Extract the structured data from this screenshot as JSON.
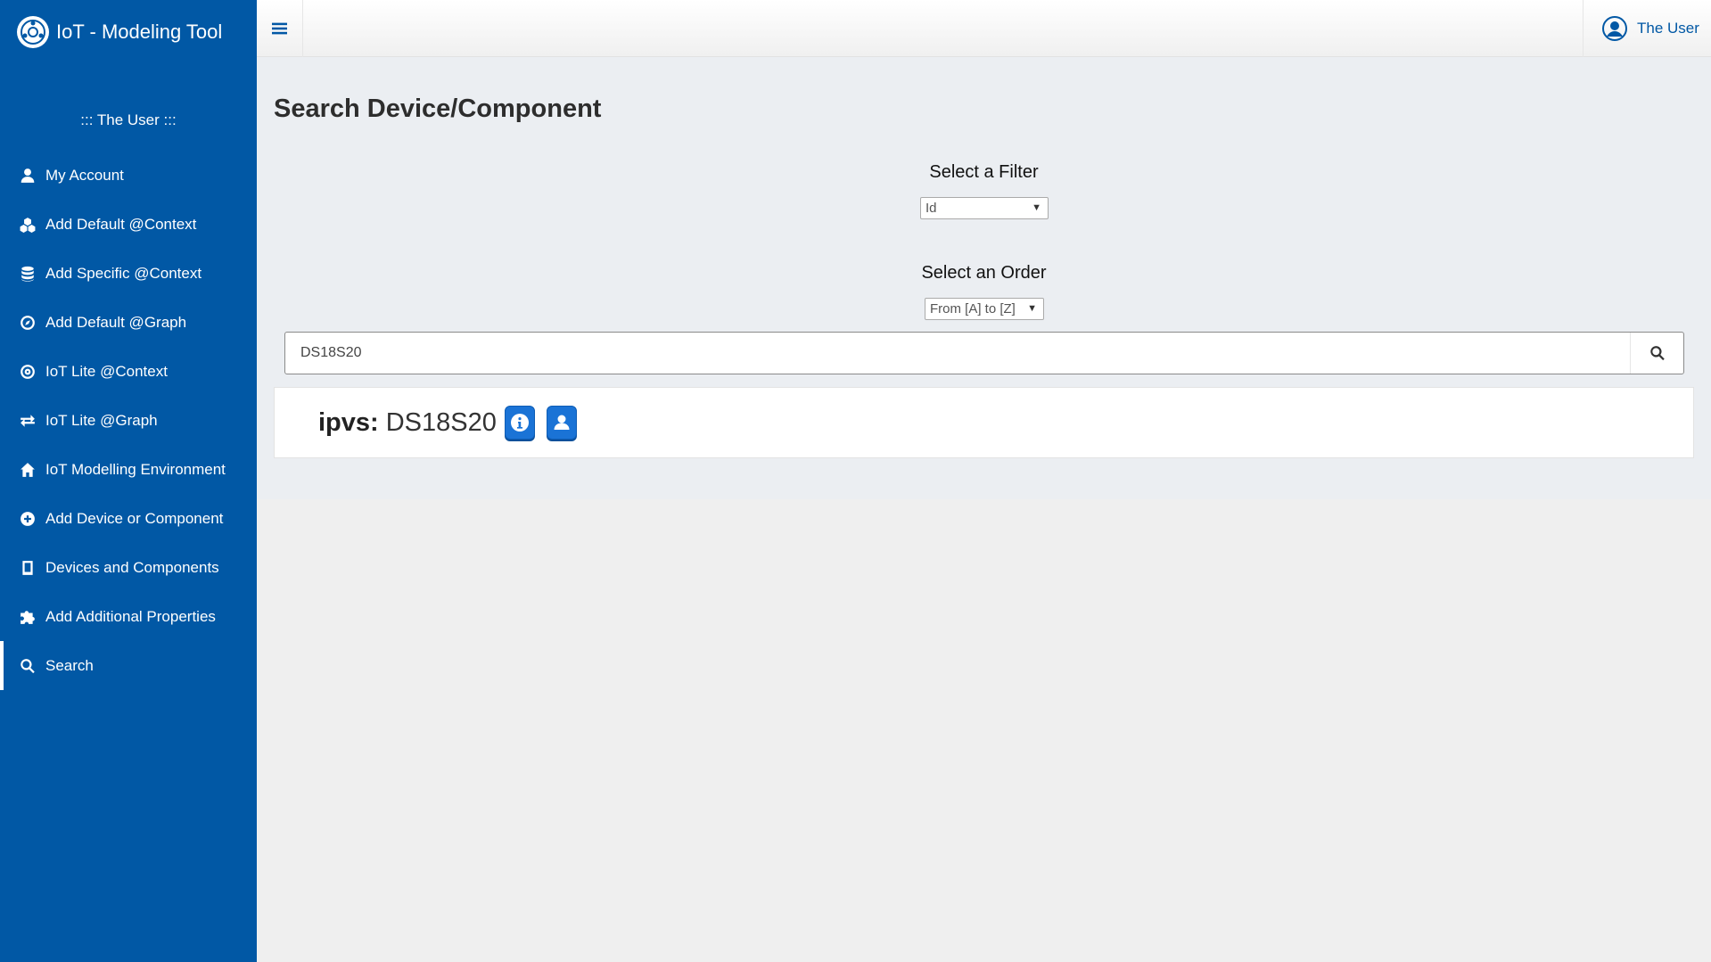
{
  "app": {
    "title": "IoT - Modeling Tool",
    "logo_icon": "iot-logo-icon"
  },
  "sidebar": {
    "user_line": "::: The User :::",
    "items": [
      {
        "label": "My Account",
        "icon": "user-icon"
      },
      {
        "label": "Add Default @Context",
        "icon": "cubes-icon"
      },
      {
        "label": "Add Specific @Context",
        "icon": "database-icon"
      },
      {
        "label": "Add Default @Graph",
        "icon": "compass-icon"
      },
      {
        "label": "IoT Lite @Context",
        "icon": "bullseye-icon"
      },
      {
        "label": "IoT Lite @Graph",
        "icon": "exchange-icon"
      },
      {
        "label": "IoT Modelling Environment",
        "icon": "home-icon"
      },
      {
        "label": "Add Device or Component",
        "icon": "plus-circle-icon"
      },
      {
        "label": "Devices and Components",
        "icon": "tablet-icon"
      },
      {
        "label": "Add Additional Properties",
        "icon": "puzzle-icon"
      },
      {
        "label": "Search",
        "icon": "search-icon",
        "active": true
      }
    ],
    "color": "#0158a5"
  },
  "topbar": {
    "menu_icon": "hamburger-icon",
    "user_name": "The User"
  },
  "main": {
    "page_title": "Search Device/Component",
    "filter": {
      "label": "Select a Filter",
      "selected": "Id"
    },
    "order": {
      "label": "Select an Order",
      "selected": "From [A] to [Z]"
    },
    "search": {
      "value": "DS18S20",
      "placeholder": ""
    },
    "results": [
      {
        "prefix": "ipvs:",
        "name": "DS18S20"
      }
    ]
  }
}
